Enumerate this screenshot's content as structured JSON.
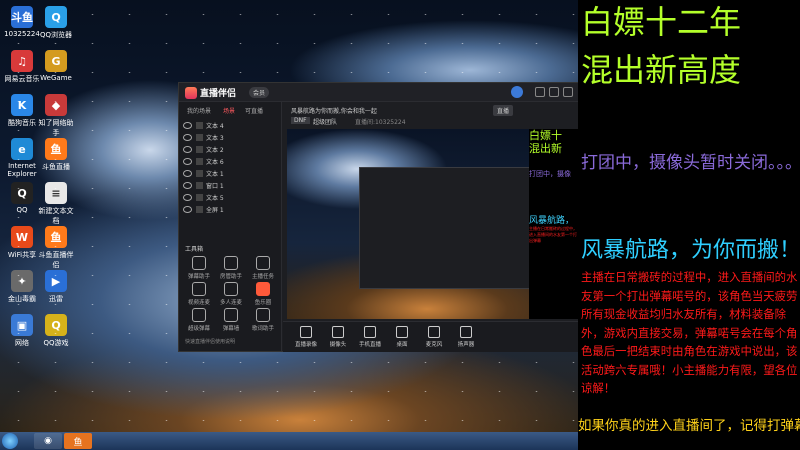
{
  "desktop": {
    "icons": [
      {
        "label": "10325224",
        "glyph": "斗鱼",
        "color": "#2a6fd6"
      },
      {
        "label": "QQ浏览器",
        "glyph": "Q",
        "color": "#2aa0e8"
      },
      {
        "label": "网易云音乐",
        "glyph": "♫",
        "color": "#d83a3a"
      },
      {
        "label": "WeGame",
        "glyph": "G",
        "color": "#d49b1f"
      },
      {
        "label": "酷狗音乐",
        "glyph": "K",
        "color": "#2a87e8"
      },
      {
        "label": "知了网络助手",
        "glyph": "◆",
        "color": "#c83a3a"
      },
      {
        "label": "Internet Explorer",
        "glyph": "e",
        "color": "#1f8ad6"
      },
      {
        "label": "斗鱼直播",
        "glyph": "鱼",
        "color": "#ff7a1a"
      },
      {
        "label": "QQ",
        "glyph": "Q",
        "color": "#222"
      },
      {
        "label": "新建文本文档",
        "glyph": "≡",
        "color": "#e8e8e8"
      },
      {
        "label": "WiFi共享",
        "glyph": "W",
        "color": "#e84a1a"
      },
      {
        "label": "斗鱼直播伴侣",
        "glyph": "鱼",
        "color": "#ff7a1a"
      },
      {
        "label": "金山毒霸",
        "glyph": "✦",
        "color": "#6a6a6a"
      },
      {
        "label": "迅雷",
        "glyph": "▶",
        "color": "#2a6fd6"
      },
      {
        "label": "网络",
        "glyph": "▣",
        "color": "#3a7ad6"
      },
      {
        "label": "QQ游戏",
        "glyph": "Q",
        "color": "#d6b21a"
      }
    ]
  },
  "app": {
    "name": "直播伴侣",
    "vip": "会员",
    "tabs": [
      "我的场景",
      "场景",
      "可直播"
    ],
    "scenes": [
      "文本 4",
      "文本 3",
      "文本 2",
      "文本 6",
      "文本 1",
      "窗口 1",
      "文本 5",
      "全屏 1"
    ],
    "tools_title": "工具箱",
    "tools": [
      {
        "label": "弹幕助手",
        "hot": false
      },
      {
        "label": "房管助手",
        "hot": false
      },
      {
        "label": "主播任务",
        "hot": false
      },
      {
        "label": "视频连麦",
        "hot": false
      },
      {
        "label": "多人连麦",
        "hot": false
      },
      {
        "label": "鱼乐圈",
        "hot": true
      },
      {
        "label": "超级弹幕",
        "hot": false
      },
      {
        "label": "弹幕墙",
        "hot": false
      },
      {
        "label": "歌词助手",
        "hot": false
      }
    ],
    "tip": "快速直播伴侣使用说明",
    "preview_title": "风暴航路为你而搬,你会和我一起",
    "preview_tag": "直播",
    "preview_meta": [
      "DNF",
      "超级团队",
      "直播间:10325224"
    ],
    "bottom": [
      "直播录像",
      "摄像头",
      "手机直播",
      "桌面",
      "麦克风",
      "扬声器"
    ],
    "side_yellow": [
      "白嫖十",
      "混出新"
    ],
    "side_purple": "打团中，摄像",
    "side_cyan": "风暴航路，",
    "side_red": "主播在日常搬砖的过程中，进入直播间的水友第一个打出弹幕"
  },
  "overlay": {
    "title1": "白嫖十二年",
    "title2": "混出新高度",
    "status": "打团中，摄像头暂时关闭。。。",
    "slogan": "风暴航路，为你而搬！",
    "rules": "主播在日常搬砖的过程中，进入直播间的水友第一个打出弹幕喏号的，该角色当天疲劳所有现金收益均归水友所有，材料装备除外，游戏内直接交易，弹幕喏号会在每个角色最后一把结束时由角色在游戏中说出，该活动跨六专属哦！小主播能力有限，望各位谅解！",
    "footer": "如果你真的进入直播间了，记得打弹幕参加哦"
  },
  "taskbar": {
    "items": [
      "◉",
      "鱼"
    ]
  }
}
